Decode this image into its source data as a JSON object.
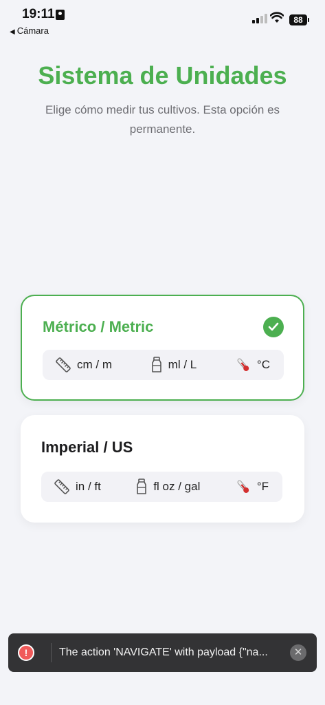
{
  "status_bar": {
    "time": "19:11",
    "back_label": "Cámara",
    "battery": "88"
  },
  "header": {
    "title": "Sistema de Unidades",
    "subtitle": "Elige cómo medir tus cultivos. Esta opción es permanente."
  },
  "options": [
    {
      "title": "Métrico / Metric",
      "selected": true,
      "length": "cm / m",
      "volume": "ml / L",
      "temperature": "°C"
    },
    {
      "title": "Imperial / US",
      "selected": false,
      "length": "in / ft",
      "volume": "fl oz / gal",
      "temperature": "°F"
    }
  ],
  "toast": {
    "message": "The action 'NAVIGATE' with payload {\"na..."
  },
  "colors": {
    "accent": "#4caf50",
    "background": "#f3f4f8",
    "toast_bg": "#333335",
    "error": "#f05a5a"
  }
}
